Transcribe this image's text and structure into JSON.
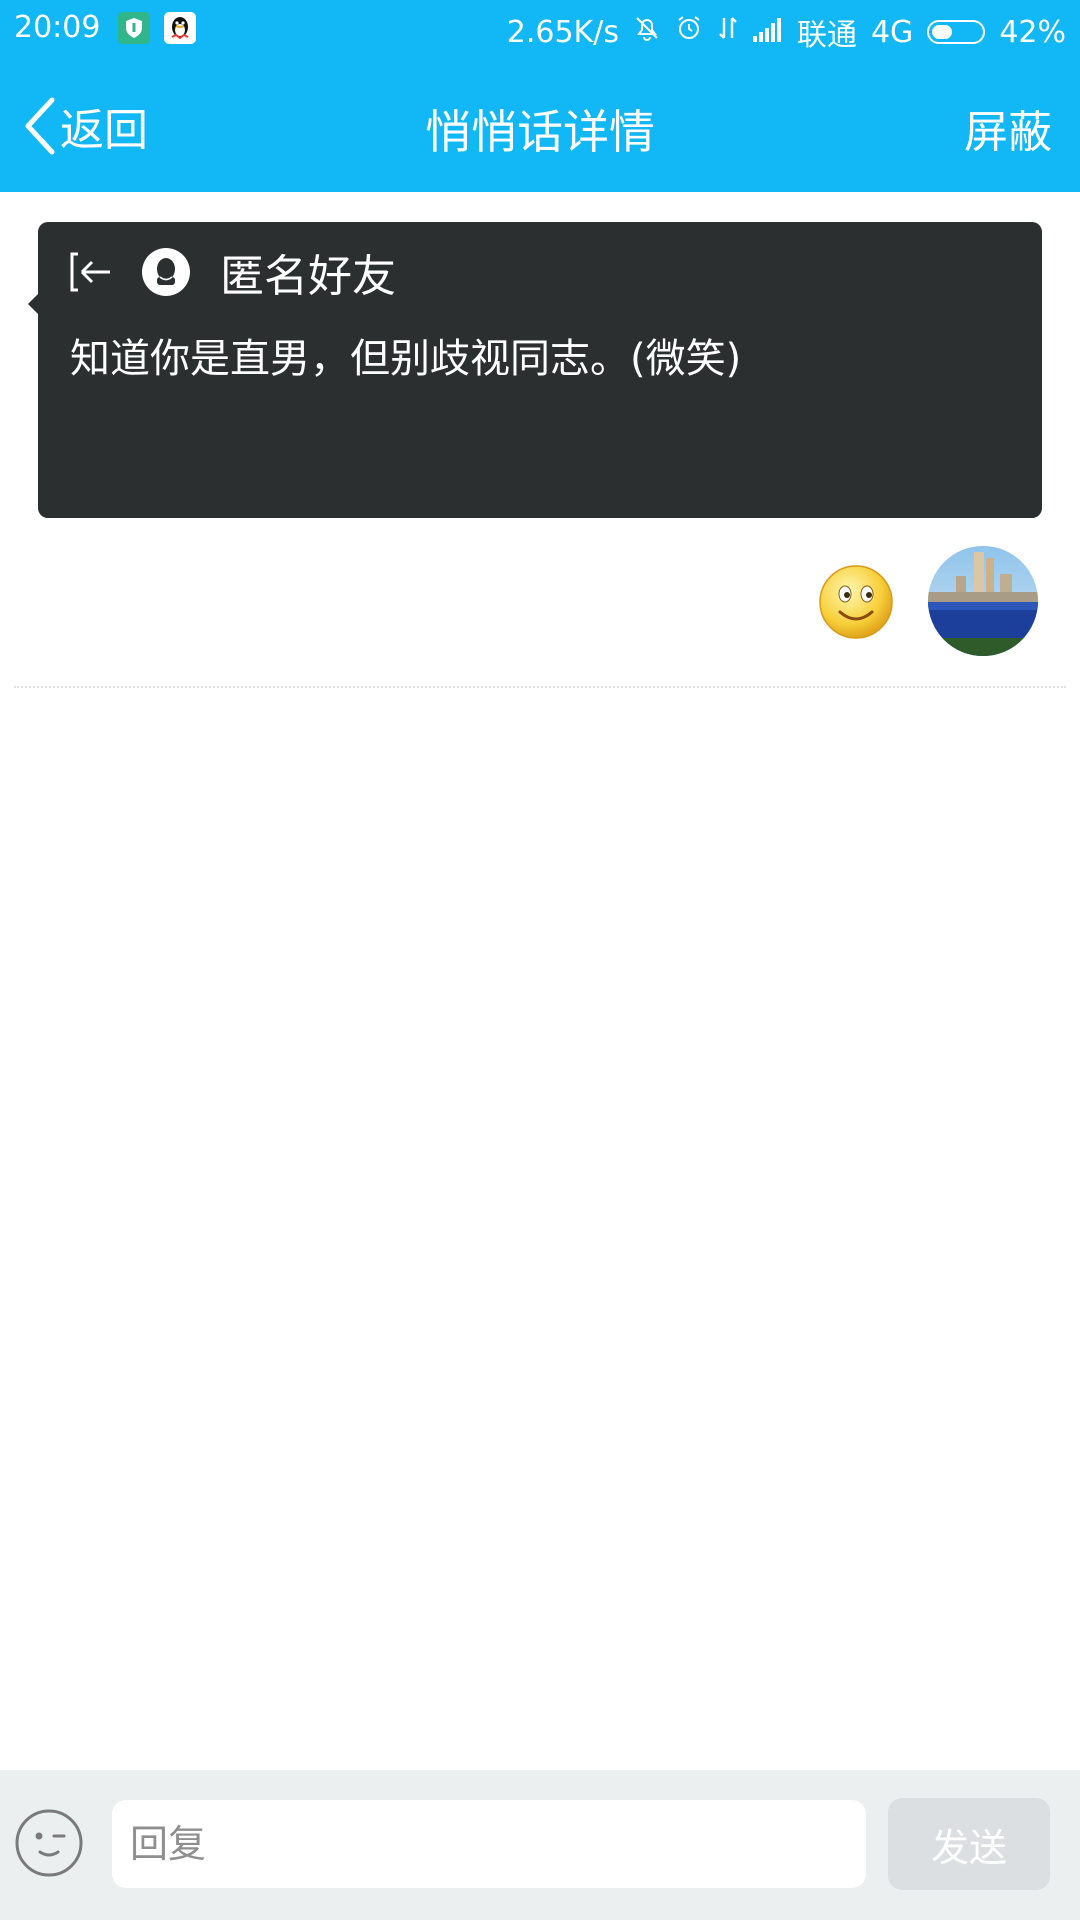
{
  "status_bar": {
    "time": "20:09",
    "net_speed": "2.65K/s",
    "carrier": "联通",
    "network": "4G",
    "battery": "42%",
    "battery_level": 0.42
  },
  "nav": {
    "back_label": "返回",
    "title": "悄悄话详情",
    "action_label": "屏蔽"
  },
  "message_card": {
    "sender": "匿名好友",
    "text": "知道你是直男，但别歧视同志。(微笑)"
  },
  "reply_bar": {
    "input_placeholder": "回复",
    "send_label": "发送"
  },
  "colors": {
    "header": "#12b7f5",
    "card": "#2b2f30",
    "bottom_bar": "#eceff0"
  }
}
